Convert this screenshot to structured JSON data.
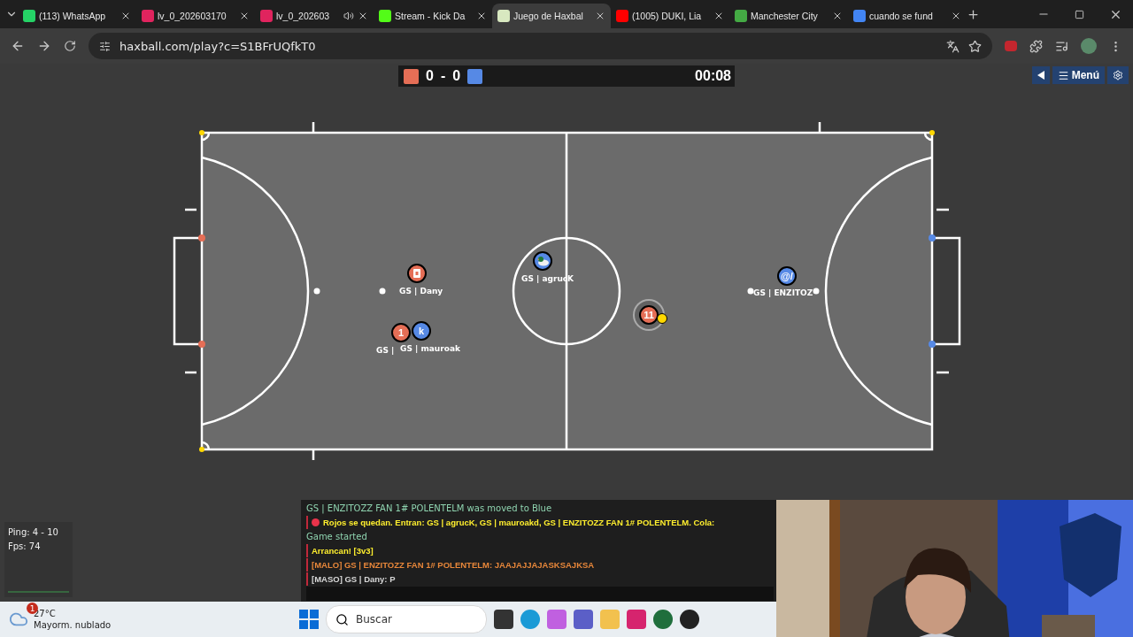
{
  "tabs": [
    {
      "title": "(113) WhatsApp",
      "selected": false
    },
    {
      "title": "lv_0_202603170",
      "selected": false
    },
    {
      "title": "lv_0_202603",
      "selected": false,
      "audio": true
    },
    {
      "title": "Stream - Kick Da",
      "selected": false
    },
    {
      "title": "Juego de Haxbal",
      "selected": true
    },
    {
      "title": "(1005) DUKI, Lia",
      "selected": false
    },
    {
      "title": "Manchester City",
      "selected": false
    },
    {
      "title": "cuando se fund",
      "selected": false
    }
  ],
  "address": "haxball.com/play?c=S1BFrUQfkT0",
  "scoreboard": {
    "red": "0",
    "separator": "-",
    "blue": "0",
    "time": "00:08"
  },
  "menu_button": "Menú",
  "players": [
    {
      "kind": "red",
      "name": "GS | Dany",
      "own": false
    },
    {
      "kind": "blue",
      "name": "GS | agrucK",
      "own": false
    },
    {
      "kind": "blue",
      "avatar": "@/",
      "name": "GS | ENZITOZ",
      "own": false
    },
    {
      "kind": "red",
      "avatar": "1",
      "name": "GS |",
      "own": false
    },
    {
      "kind": "blue",
      "avatar": "k",
      "name": "GS | mauroak",
      "own": false
    },
    {
      "kind": "red",
      "avatar": "11",
      "own": true
    }
  ],
  "stats": {
    "ping": "Ping: 4 - 10",
    "fps": "Fps: 74"
  },
  "chat": [
    {
      "kind": "system",
      "text": "GS | ENZITOZZ FAN 1# POLENTELM was moved to Blue"
    },
    {
      "kind": "announce",
      "text": "Rojos se quedan. Entran: GS | agrucK, GS | mauroakd, GS | ENZITOZZ FAN 1# POLENTELM. Cola:",
      "dot": true
    },
    {
      "kind": "system",
      "text": "Game started"
    },
    {
      "kind": "announce",
      "text": "Arrancan! [3v3]",
      "dot": false
    },
    {
      "kind": "red_chat",
      "text": "[MALO] GS | ENZITOZZ FAN 1# POLENTELM: JAAJAJJAJASKSAJKSA"
    },
    {
      "kind": "chat",
      "text": "[MASO] GS | Dany: P"
    }
  ],
  "taskbar": {
    "weather_badge": "1",
    "temperature": "27°C",
    "weather": "Mayorm. nublado",
    "search_placeholder": "Buscar"
  }
}
